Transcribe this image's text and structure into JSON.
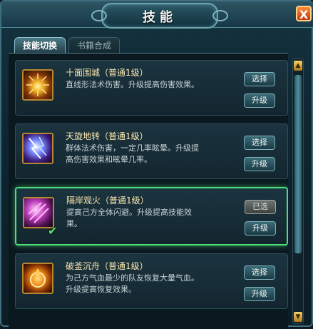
{
  "window": {
    "title": "技能",
    "close_label": "X"
  },
  "tabs": [
    {
      "label": "技能切换",
      "active": true
    },
    {
      "label": "书籍合成",
      "active": false
    }
  ],
  "skills": [
    {
      "name": "十面围城（普通1级）",
      "description": "直线形法术伤害。升级提高伤害效果。",
      "icon": "sunburst-icon",
      "select_label": "选择",
      "upgrade_label": "升级",
      "selected": false
    },
    {
      "name": "天旋地转（普通1级）",
      "description": "群体法术伤害，一定几率眩晕。升级提高伤害效果和眩晕几率。",
      "icon": "lightning-icon",
      "select_label": "选择",
      "upgrade_label": "升级",
      "selected": false
    },
    {
      "name": "隔岸观火（普通1级）",
      "description": "提高己方全体闪避。升级提高技能效果。",
      "icon": "fire-arrows-icon",
      "select_label": "已选",
      "upgrade_label": "升级",
      "selected": true
    },
    {
      "name": "破釜沉舟（普通1级）",
      "description": "为己方气血最少的队友恢复大量气血。升级提高恢复效果。",
      "icon": "flame-swirl-icon",
      "select_label": "选择",
      "upgrade_label": "升级",
      "selected": false
    }
  ],
  "colors": {
    "selected_border": "#4fdc7a",
    "name_text": "#fbe8b0"
  }
}
